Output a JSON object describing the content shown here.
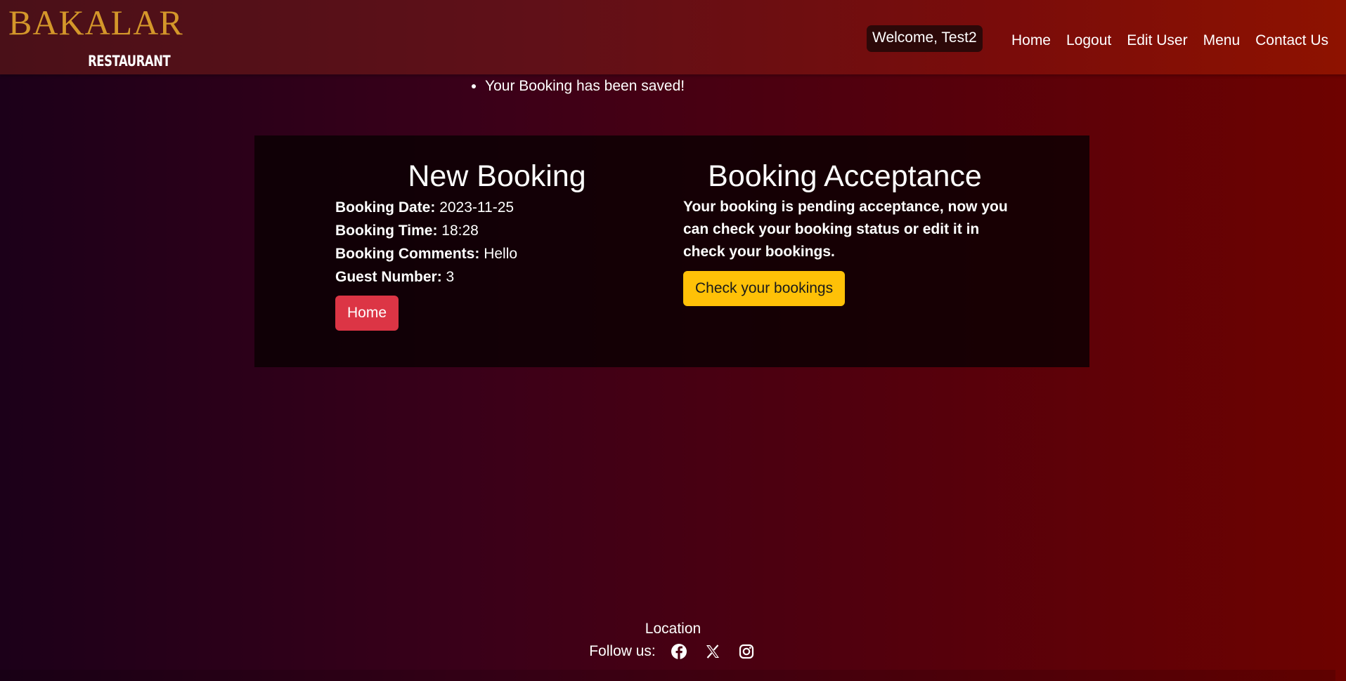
{
  "brand": {
    "name": "BAKALAR",
    "subtitle": "RESTAURANT"
  },
  "header": {
    "welcome": "Welcome, Test2",
    "nav": [
      "Home",
      "Logout",
      "Edit User",
      "Menu",
      "Contact Us"
    ]
  },
  "messages": [
    "Your Booking has been saved!"
  ],
  "booking": {
    "title": "New Booking",
    "date_label": "Booking Date:",
    "date_value": "2023-11-25",
    "time_label": "Booking Time:",
    "time_value": "18:28",
    "comments_label": "Booking Comments:",
    "comments_value": "Hello",
    "guests_label": "Guest Number:",
    "guests_value": "3",
    "home_button": "Home"
  },
  "acceptance": {
    "title": "Booking Acceptance",
    "text": "Your booking is pending acceptance, now you can check your booking status or edit it in check your bookings.",
    "button": "Check your bookings"
  },
  "footer": {
    "location": "Location",
    "follow_label": "Follow us:",
    "social_icons": [
      "facebook-icon",
      "x-icon",
      "instagram-icon"
    ]
  },
  "colors": {
    "brand_gold": "#d4972a",
    "home_button": "#dc3545",
    "check_button": "#ffc107"
  }
}
